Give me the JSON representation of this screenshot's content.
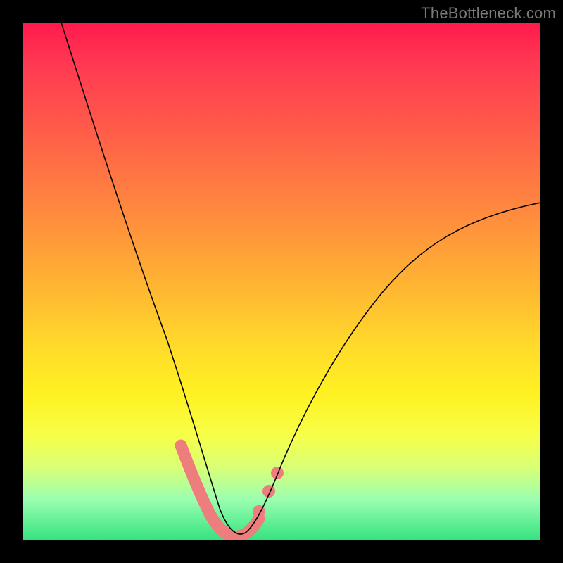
{
  "watermark": "TheBottleneck.com",
  "colors": {
    "frame": "#000000",
    "highlight": "#ee7d7d",
    "gradient_top": "#ff1a4d",
    "gradient_bottom": "#34e27e"
  },
  "chart_data": {
    "type": "line",
    "title": "",
    "xlabel": "",
    "ylabel": "",
    "xlim": [
      0,
      100
    ],
    "ylim": [
      0,
      100
    ],
    "note": "No numeric axes shown; values estimated from pixel position within the 736×736 plot area, x and y normalized 0–100 (y increases upward).",
    "series": [
      {
        "name": "curve",
        "x": [
          7,
          10,
          15,
          20,
          25,
          28,
          30,
          33,
          36,
          38,
          40,
          42,
          44,
          47,
          50,
          55,
          60,
          65,
          70,
          75,
          80,
          85,
          90,
          95,
          100
        ],
        "y": [
          100,
          90,
          74,
          58,
          43,
          34,
          28,
          20,
          12,
          7,
          4,
          2,
          1,
          1.5,
          4,
          10,
          18,
          26,
          33,
          40,
          46,
          52,
          57,
          61,
          65
        ]
      }
    ],
    "highlight_band": {
      "description": "Thick salmon segment hugging the valley of the curve",
      "x_range": [
        31,
        48
      ],
      "y_range": [
        1,
        20
      ]
    },
    "highlight_right_markers": {
      "description": "Short dashed salmon markers on ascending limb",
      "points": [
        {
          "x": 46,
          "y": 13
        },
        {
          "x": 49,
          "y": 17
        }
      ]
    }
  }
}
